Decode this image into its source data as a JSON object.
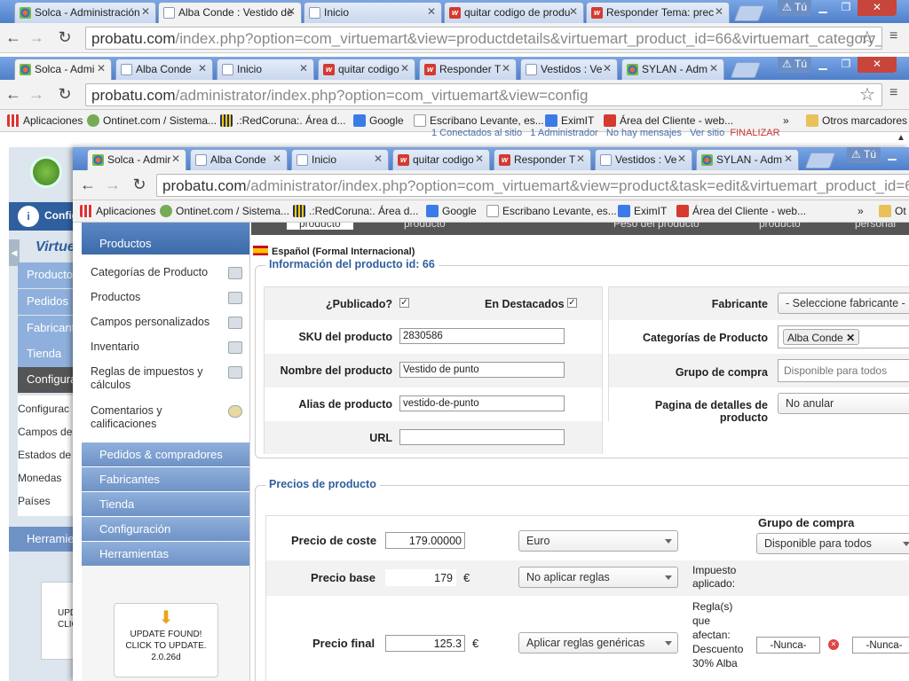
{
  "win1": {
    "tabs": [
      {
        "label": "Solca - Administración"
      },
      {
        "label": "Alba Conde : Vestido de"
      },
      {
        "label": "Inicio"
      },
      {
        "label": "quitar codigo de produ"
      },
      {
        "label": "Responder Tema: prec"
      }
    ],
    "user_label": "Tú",
    "url_host": "probatu.com",
    "url_path": "/index.php?option=com_virtuemart&view=productdetails&virtuemart_product_id=66&virtuemart_category_"
  },
  "win2": {
    "tabs": [
      {
        "label": "Solca - Admi"
      },
      {
        "label": "Alba Conde"
      },
      {
        "label": "Inicio"
      },
      {
        "label": "quitar codigo"
      },
      {
        "label": "Responder T"
      },
      {
        "label": "Vestidos : Ve"
      },
      {
        "label": "SYLAN - Adm"
      }
    ],
    "user_label": "Tú",
    "url_host": "probatu.com",
    "url_path": "/administrator/index.php?option=com_virtuemart&view=config",
    "bookmarks": [
      "Aplicaciones",
      "Ontinet.com / Sistema...",
      ".:RedCoruna:. Área d...",
      "Google",
      "Escribano Levante, es...",
      "EximIT",
      "Área del Cliente - web..."
    ],
    "bookmarks_more": "»",
    "other_bookmarks": "Otros marcadores",
    "status": [
      "1 Conectados al sitio",
      "1 Administrador",
      "No hay mensajes",
      "Ver sitio",
      "FINALIZAR"
    ],
    "sidebar": {
      "config_label": "Config",
      "items": [
        "Producto",
        "Pedidos",
        "Fabricant",
        "Tienda",
        "Configura"
      ],
      "subitems": [
        "Configurac",
        "Campos de",
        "Estados de",
        "Monedas",
        "Países"
      ],
      "tools": "Herramie",
      "update": "UPD CLIC"
    }
  },
  "win3": {
    "tabs": [
      {
        "label": "Solca - Admir"
      },
      {
        "label": "Alba Conde"
      },
      {
        "label": "Inicio"
      },
      {
        "label": "quitar codigo"
      },
      {
        "label": "Responder T"
      },
      {
        "label": "Vestidos : Ve"
      },
      {
        "label": "SYLAN - Adm"
      }
    ],
    "user_label": "Tú",
    "url_host": "probatu.com",
    "url_path": "/administrator/index.php?option=com_virtuemart&view=product&task=edit&virtuemart_product_id=66",
    "bookmarks": [
      "Aplicaciones",
      "Ontinet.com / Sistema...",
      ".:RedCoruna:. Área d...",
      "Google",
      "Escribano Levante, es...",
      "EximIT",
      "Área del Cliente - web..."
    ],
    "bookmarks_more": "»",
    "other_bookmarks": "Ot",
    "top_tabs": [
      "producto",
      "producto",
      "Peso del producto",
      "producto",
      "personal"
    ],
    "menu": {
      "header": "Productos",
      "items": [
        "Categorías de Producto",
        "Productos",
        "Campos personalizados",
        "Inventario",
        "Reglas de impuestos y cálculos",
        "Comentarios y calificaciones"
      ],
      "sections": [
        "Pedidos & compradores",
        "Fabricantes",
        "Tienda",
        "Configuración",
        "Herramientas"
      ],
      "update": {
        "line1": "UPDATE FOUND!",
        "line2": "CLICK TO UPDATE.",
        "version": "2.0.26d"
      }
    },
    "lang": "Español (Formal Internacional)",
    "info_title": "Información del producto id: 66",
    "fields": {
      "published_label": "¿Publicado?",
      "featured_label": "En Destacados",
      "sku_label": "SKU del producto",
      "sku": "2830586",
      "name_label": "Nombre del producto",
      "name": "Vestido de punto",
      "alias_label": "Alias de producto",
      "alias": "vestido-de-punto",
      "url_label": "URL",
      "url": "",
      "manufacturer_label": "Fabricante",
      "manufacturer": "- Seleccione fabricante -",
      "categories_label": "Categorías de Producto",
      "category_tag": "Alba Conde",
      "shopper_group_label": "Grupo de compra",
      "shopper_group_placeholder": "Disponible para todos",
      "details_page_label": "Pagina de detalles de producto",
      "details_page": "No anular"
    },
    "prices_title": "Precios de producto",
    "prices": {
      "cost_label": "Precio de coste",
      "cost": "179.00000",
      "currency": "Euro",
      "shopper_group_header": "Grupo de compra",
      "shopper_group": "Disponible para todos",
      "base_label": "Precio base",
      "base": "179",
      "euro_sign": "€",
      "rules": "No aplicar reglas",
      "tax_applied": "Impuesto aplicado:",
      "final_label": "Precio final",
      "final": "125.3",
      "rules2": "Aplicar reglas genéricas",
      "rules_affect": "Regla(s) que afectan: Descuento 30% Alba",
      "never1": "-Nunca-",
      "never2": "-Nunca-"
    }
  }
}
